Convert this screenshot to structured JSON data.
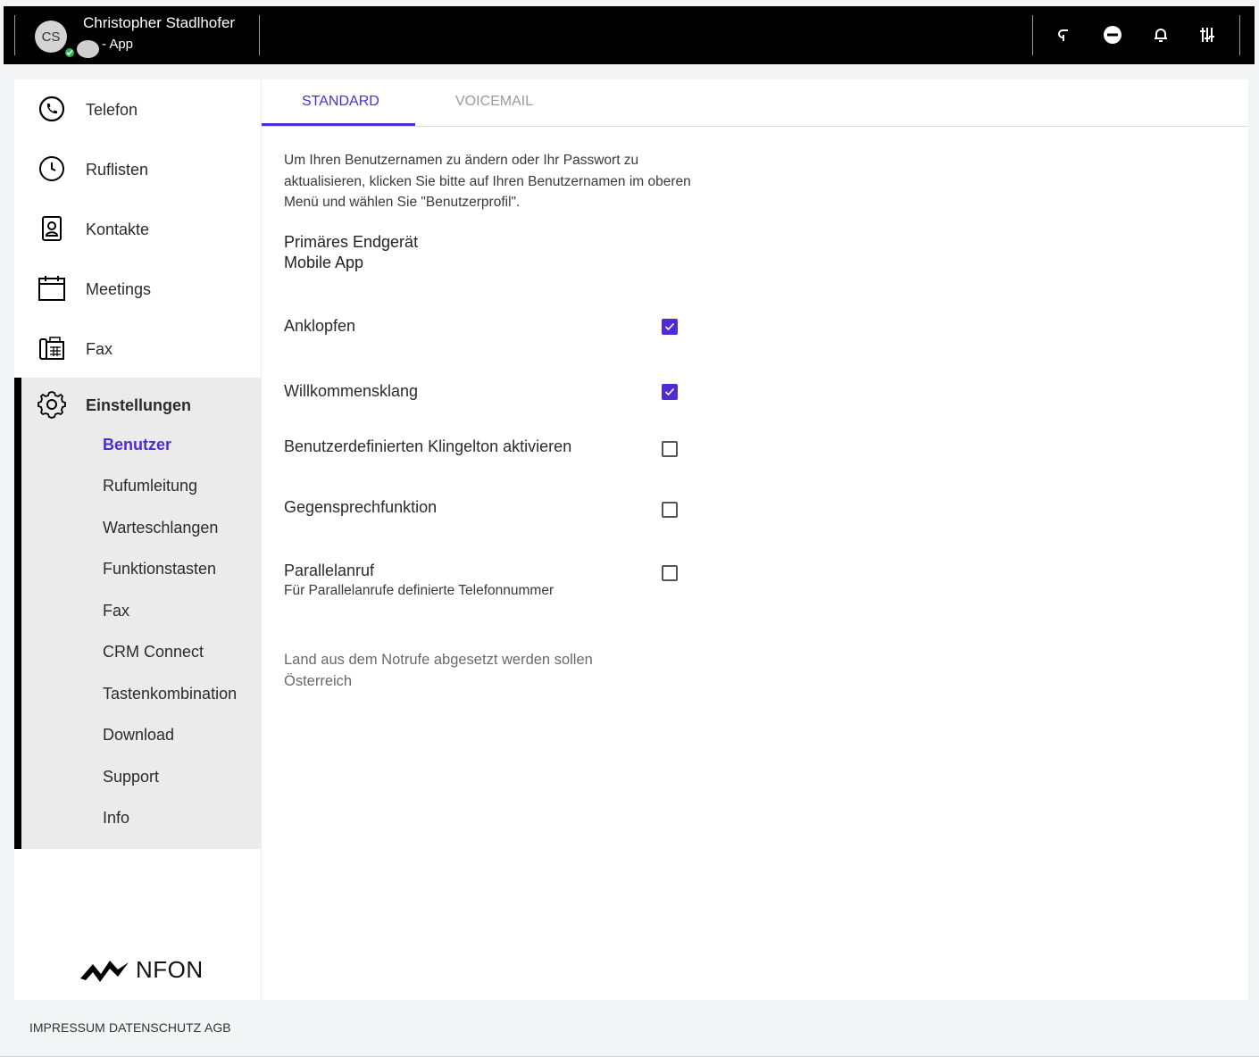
{
  "header": {
    "avatar_initials": "CS",
    "user_name": "Christopher Stadlhofer",
    "device_label": "- App",
    "status_color": "#2eb24f",
    "icons": [
      "call-return-icon",
      "do-not-disturb-icon",
      "bell-icon",
      "sliders-icon"
    ]
  },
  "sidebar": {
    "items": [
      {
        "label": "Telefon",
        "icon": "phone-icon"
      },
      {
        "label": "Ruflisten",
        "icon": "clock-icon"
      },
      {
        "label": "Kontakte",
        "icon": "contact-card-icon"
      },
      {
        "label": "Meetings",
        "icon": "calendar-icon"
      },
      {
        "label": "Fax",
        "icon": "fax-icon"
      }
    ],
    "settings": {
      "label": "Einstellungen",
      "icon": "gear-icon",
      "subitems": [
        "Benutzer",
        "Rufumleitung",
        "Warteschlangen",
        "Funktionstasten",
        "Fax",
        "CRM Connect",
        "Tastenkombination",
        "Download",
        "Support",
        "Info"
      ],
      "active": "Benutzer"
    },
    "logo_text": "NFON"
  },
  "tabs": [
    {
      "label": "STANDARD",
      "active": true
    },
    {
      "label": "VOICEMAIL",
      "active": false
    }
  ],
  "content": {
    "info_text": "Um Ihren Benutzernamen zu ändern oder Ihr Passwort zu aktualisieren, klicken Sie bitte auf Ihren Benutzernamen im oberen Menü und wählen Sie \"Benutzerprofil\".",
    "primary_device_label": "Primäres Endgerät",
    "primary_device_value": "Mobile App",
    "settings": [
      {
        "label": "Anklopfen",
        "checked": true
      },
      {
        "label": "Willkommensklang",
        "checked": true
      },
      {
        "label": "Benutzerdefinierten Klingelton aktivieren",
        "checked": false
      },
      {
        "label": "Gegensprechfunktion",
        "checked": false
      },
      {
        "label": "Parallelanruf",
        "sublabel": "Für Parallelanrufe definierte Telefonnummer",
        "checked": false
      }
    ],
    "country_label": "Land aus dem Notrufe abgesetzt werden sollen",
    "country_value": "Österreich"
  },
  "footer": {
    "links": [
      "IMPRESSUM",
      "DATENSCHUTZ",
      "AGB"
    ]
  },
  "colors": {
    "accent": "#4f2bd6",
    "header_bg": "#000000",
    "sidebar_active_bg": "#ebebeb"
  }
}
